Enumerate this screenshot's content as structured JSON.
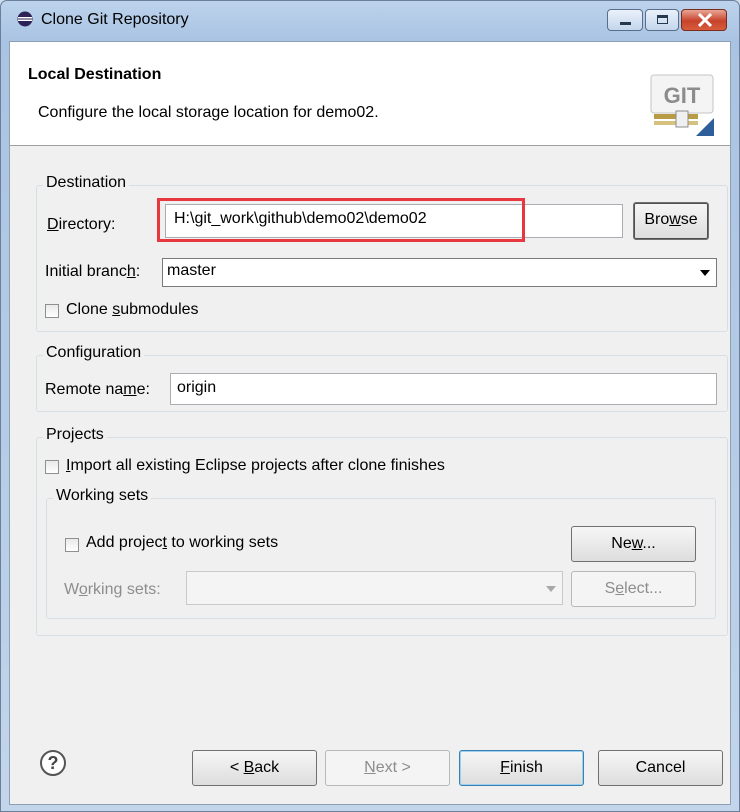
{
  "window": {
    "title": "Clone Git Repository",
    "controls": {
      "minimize": "minimize",
      "maximize": "maximize",
      "close": "close"
    }
  },
  "header": {
    "title": "Local Destination",
    "description": "Configure the local storage location for demo02.",
    "logo_text": "GIT"
  },
  "destination": {
    "group_title": "Destination",
    "directory_label_pre": "",
    "directory_label_key": "D",
    "directory_label_post": "irectory:",
    "directory_value": "H:\\git_work\\github\\demo02\\demo02",
    "browse_pre": "Bro",
    "browse_key": "w",
    "browse_post": "se",
    "branch_label_pre": "Initial branc",
    "branch_label_key": "h",
    "branch_label_post": ":",
    "branch_value": "master",
    "submodules_pre": "Clone ",
    "submodules_key": "s",
    "submodules_post": "ubmodules",
    "submodules_checked": false
  },
  "configuration": {
    "group_title": "Configuration",
    "remote_label_pre": "Remote na",
    "remote_label_key": "m",
    "remote_label_post": "e:",
    "remote_value": "origin"
  },
  "projects": {
    "group_title": "Projects",
    "import_pre": "",
    "import_key": "I",
    "import_post": "mport all existing Eclipse projects after clone finishes",
    "import_checked": false,
    "working_sets": {
      "group_title": "Working sets",
      "add_pre": "Add projec",
      "add_key": "t",
      "add_post": " to working sets",
      "add_checked": false,
      "new_pre": "Ne",
      "new_key": "w",
      "new_post": "...",
      "sets_label_pre": "W",
      "sets_label_key": "o",
      "sets_label_post": "rking sets:",
      "sets_value": "",
      "select_pre": "S",
      "select_key": "e",
      "select_post": "lect..."
    }
  },
  "footer": {
    "help_glyph": "?",
    "back_pre": "< ",
    "back_key": "B",
    "back_post": "ack",
    "next_pre": "",
    "next_key": "N",
    "next_post": "ext >",
    "finish_pre": "",
    "finish_key": "F",
    "finish_post": "inish",
    "cancel_label": "Cancel"
  },
  "colors": {
    "highlight": "#e6383e",
    "title_gradient_top": "#bcd3ec",
    "client_bg": "#f0f0f0"
  }
}
